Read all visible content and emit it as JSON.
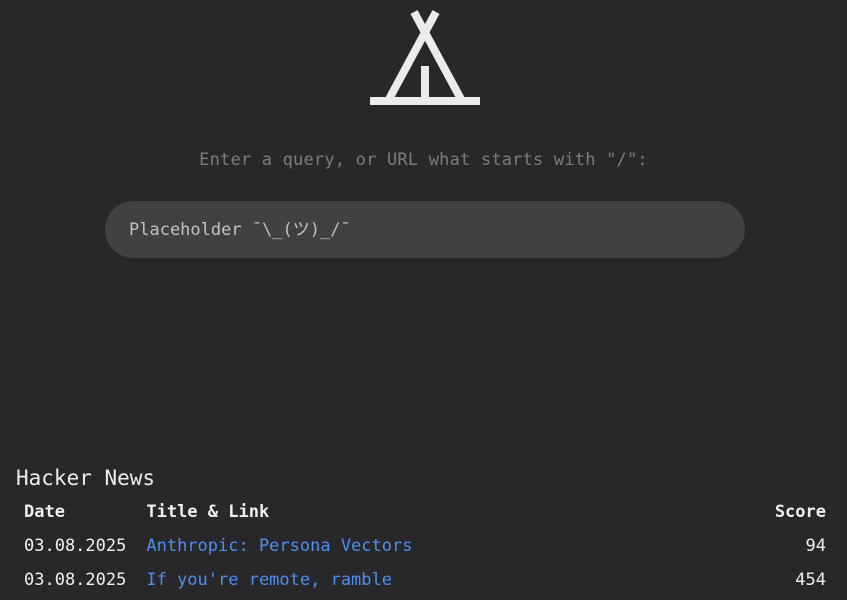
{
  "logo": {
    "icon": "tent-icon",
    "color": "#ebebeb"
  },
  "search": {
    "prompt": "Enter a query, or URL what starts with \"/\":",
    "placeholder": "Placeholder ¯\\_(ツ)_/¯",
    "value": ""
  },
  "hacker_news": {
    "title": "Hacker News",
    "columns": {
      "date": "Date",
      "title": "Title & Link",
      "score": "Score"
    },
    "rows": [
      {
        "date": "03.08.2025",
        "title": "Anthropic: Persona Vectors",
        "score": "94"
      },
      {
        "date": "03.08.2025",
        "title": "If you're remote, ramble",
        "score": "454"
      }
    ]
  },
  "colors": {
    "background": "#28282b",
    "search_box": "#414143",
    "link": "#4d8ff0",
    "prompt_text": "#7c7c80"
  }
}
